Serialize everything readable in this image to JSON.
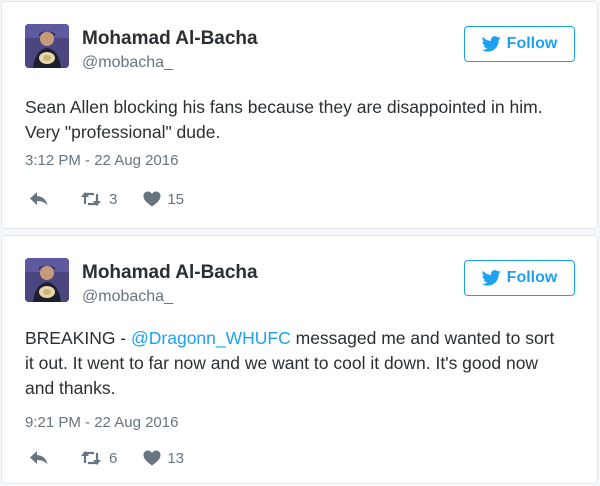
{
  "tweets": [
    {
      "name": "Mohamad Al-Bacha",
      "handle": "@mobacha_",
      "follow_label": "Follow",
      "text": "Sean Allen blocking his fans because they are disappointed in him. Very \"professional\" dude.",
      "timestamp": "3:12 PM - 22 Aug 2016",
      "retweets": "3",
      "likes": "15"
    },
    {
      "name": "Mohamad Al-Bacha",
      "handle": "@mobacha_",
      "follow_label": "Follow",
      "text_before": "BREAKING - ",
      "mention": "@Dragonn_WHUFC",
      "text_after": " messaged me and wanted to sort it out. It went to far now and we want to cool it down. It's good now and thanks.",
      "timestamp": "9:21 PM - 22 Aug 2016",
      "retweets": "6",
      "likes": "13"
    }
  ],
  "icons": {
    "bird": "twitter-bird-icon",
    "reply": "reply-icon",
    "retweet": "retweet-icon",
    "like": "heart-icon"
  },
  "colors": {
    "brand": "#1da1f2",
    "text": "#292f33",
    "muted": "#66757f",
    "border": "#e1e8ed"
  }
}
